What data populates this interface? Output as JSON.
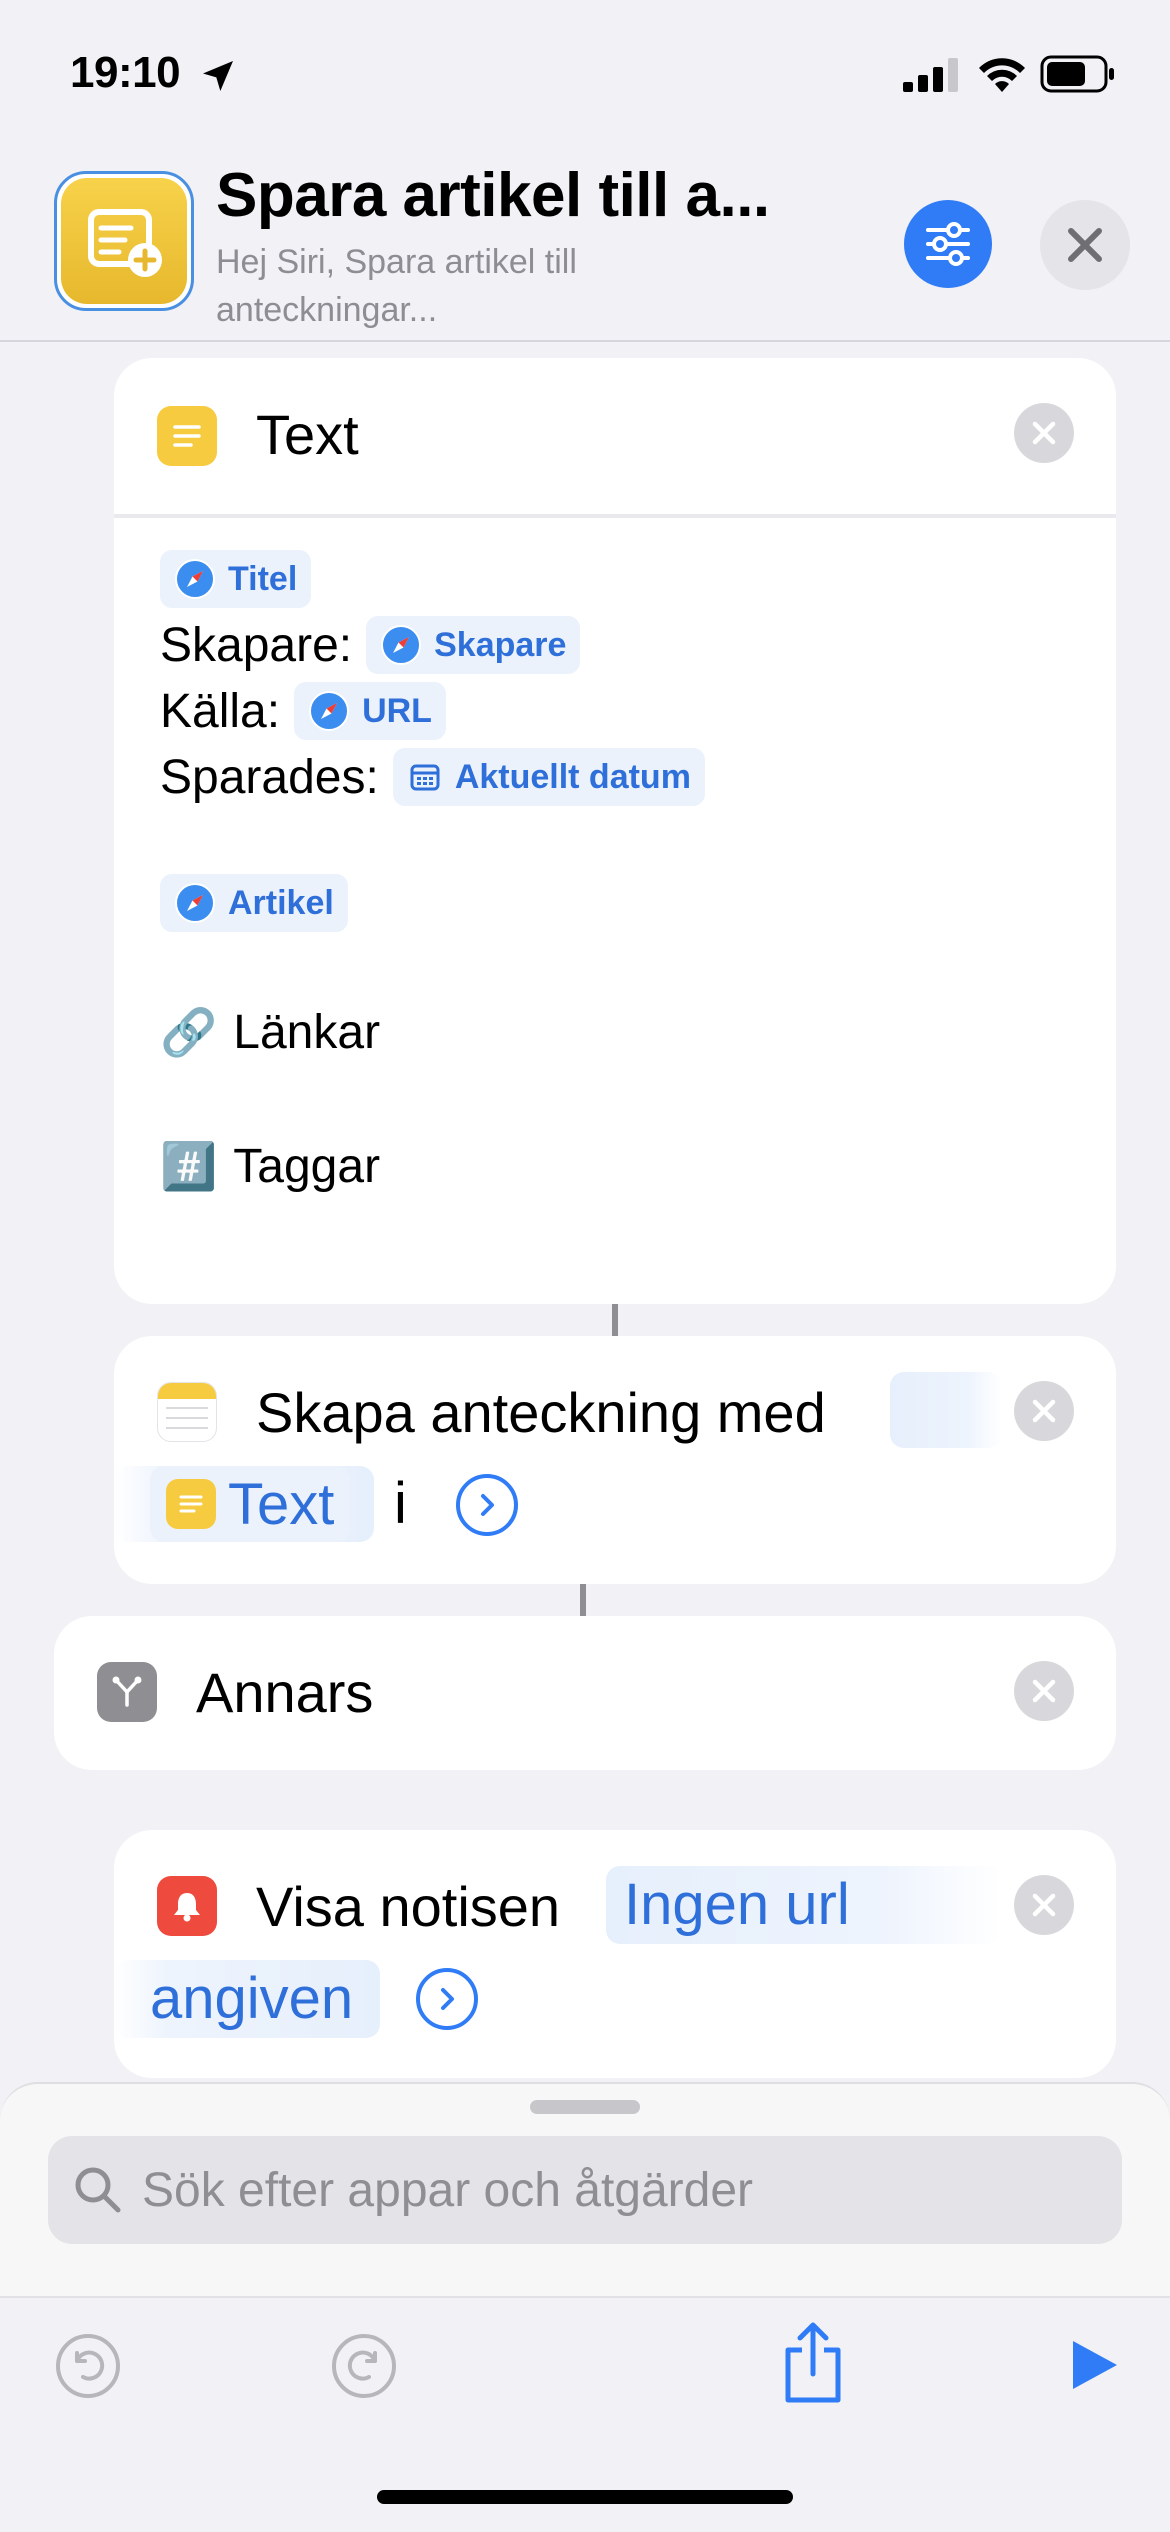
{
  "status_bar": {
    "time": "19:10"
  },
  "header": {
    "title": "Spara artikel till a...",
    "subtitle": "Hej Siri, Spara artikel till anteckningar..."
  },
  "text_action": {
    "title": "Text",
    "token_titel": "Titel",
    "label_skapare": "Skapare:",
    "token_skapare": "Skapare",
    "label_kalla": "Källa:",
    "token_url": "URL",
    "label_sparades": "Sparades:",
    "token_datum": "Aktuellt datum",
    "token_artikel": "Artikel",
    "links_emoji": "🔗",
    "links_label": "Länkar",
    "tags_emoji": "#️⃣",
    "tags_label": "Taggar"
  },
  "note_action": {
    "title": "Skapa anteckning med",
    "variable": "Text",
    "preposition": "i"
  },
  "else_action": {
    "title": "Annars"
  },
  "notify_action": {
    "title": "Visa notisen",
    "message_line1": "Ingen url",
    "message_line2": "angiven"
  },
  "search": {
    "placeholder": "Sök efter appar och åtgärder"
  },
  "colors": {
    "accent": "#2f7cf6",
    "shortcut_yellow": "#f7d24a",
    "token_blue": "#2f6fd9",
    "notify_red": "#ef4a3e",
    "else_gray": "#8e8e93"
  }
}
